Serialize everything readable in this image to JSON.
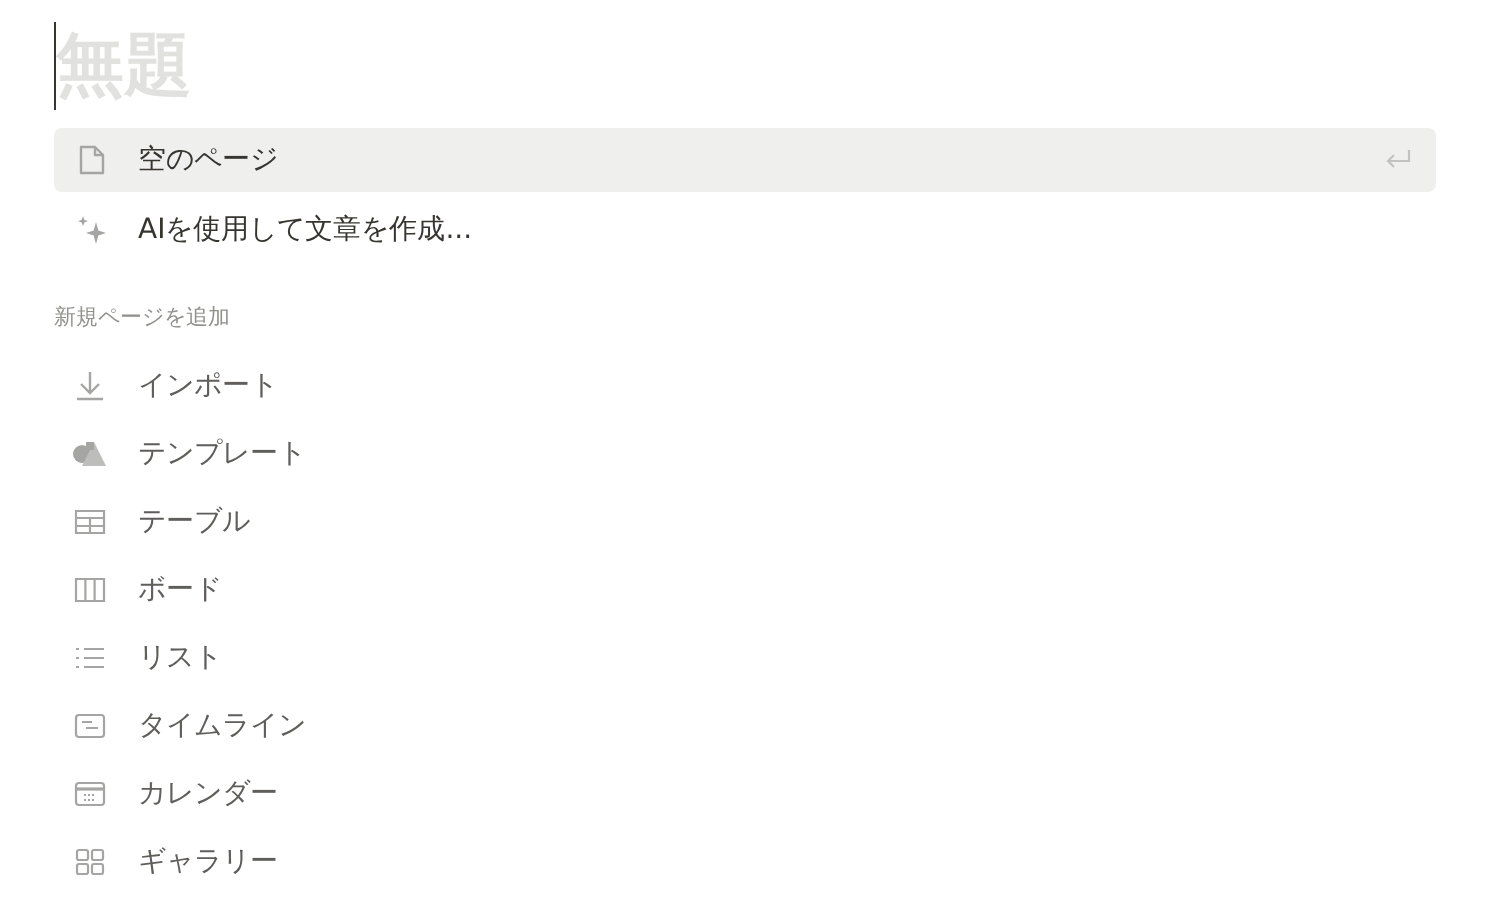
{
  "title": {
    "placeholder": "無題"
  },
  "suggestions": [
    {
      "kind": "page",
      "label": "空のページ",
      "selected": true
    },
    {
      "kind": "ai",
      "label": "AIを使用して文章を作成...",
      "selected": false
    }
  ],
  "section_label": "新規ページを追加",
  "templates": [
    {
      "kind": "import",
      "label": "インポート"
    },
    {
      "kind": "template",
      "label": "テンプレート"
    },
    {
      "kind": "table",
      "label": "テーブル"
    },
    {
      "kind": "board",
      "label": "ボード"
    },
    {
      "kind": "list",
      "label": "リスト"
    },
    {
      "kind": "timeline",
      "label": "タイムライン"
    },
    {
      "kind": "calendar",
      "label": "カレンダー"
    },
    {
      "kind": "gallery",
      "label": "ギャラリー"
    }
  ]
}
